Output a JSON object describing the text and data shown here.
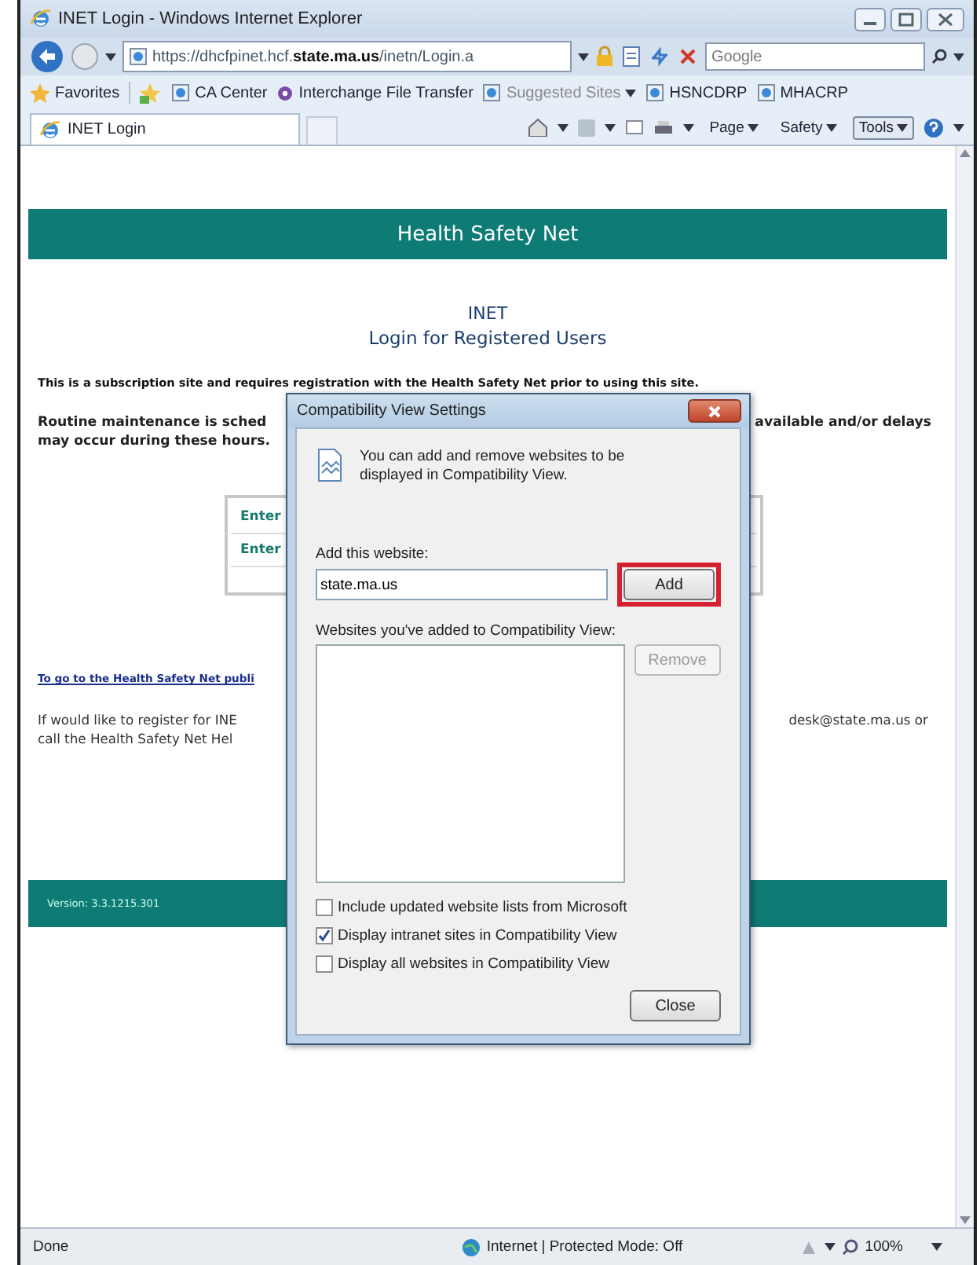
{
  "window": {
    "title": "INET Login - Windows Internet Explorer"
  },
  "address_bar": {
    "url_start": "https://dhcfpinet.hcf.",
    "url_domain": "state.ma.us",
    "url_end": "/inetn/Login.a"
  },
  "search": {
    "placeholder": "Google"
  },
  "favorites_bar": {
    "label": "Favorites",
    "items": [
      {
        "label": "CA Center",
        "kind": "page"
      },
      {
        "label": "Interchange File Transfer",
        "kind": "app"
      },
      {
        "label": "Suggested Sites",
        "kind": "dropdown"
      },
      {
        "label": "HSNCDRP",
        "kind": "page"
      },
      {
        "label": "MHACRP",
        "kind": "page"
      }
    ]
  },
  "tab": {
    "label": "INET Login"
  },
  "command_bar": [
    {
      "label": "Page",
      "selected": false
    },
    {
      "label": "Safety",
      "selected": false
    },
    {
      "label": "Tools",
      "selected": true
    }
  ],
  "page": {
    "header": "Health Safety Net",
    "title": "INET",
    "subtitle": "Login for Registered Users",
    "notice": "This is a subscription site and requires registration with the Health Safety Net prior to using this site.",
    "maintenance_left": [
      "Routine maintenance is sched",
      "may occur during these hours."
    ],
    "maintenance_right": "available and/or delays",
    "login_rows": [
      "Enter",
      "Enter"
    ],
    "link": "To go to the Health Safety Net publi",
    "register_left": [
      "If would like to register for INE",
      "call the Health Safety Net Hel"
    ],
    "register_right": "desk@state.ma.us or",
    "footer": "Version: 3.3.1215.301"
  },
  "dialog": {
    "title": "Compatibility View Settings",
    "intro": "You can add and remove websites to be displayed in Compatibility View.",
    "add_label": "Add this website:",
    "website": "state.ma.us",
    "add_button": {
      "label": "Add",
      "highlighted": true
    },
    "list_label": "Websites you've added to Compatibility View:",
    "remove_button": {
      "label": "Remove",
      "disabled": true
    },
    "options": [
      {
        "label": "Include updated website lists from Microsoft",
        "checked": false
      },
      {
        "label": "Display intranet sites in Compatibility View",
        "checked": true
      },
      {
        "label": "Display all websites in Compatibility View",
        "checked": false
      }
    ],
    "close_button": "Close"
  },
  "status_bar": {
    "text": "Done",
    "zone": "Internet | Protected Mode: Off",
    "zoom": "100%"
  }
}
